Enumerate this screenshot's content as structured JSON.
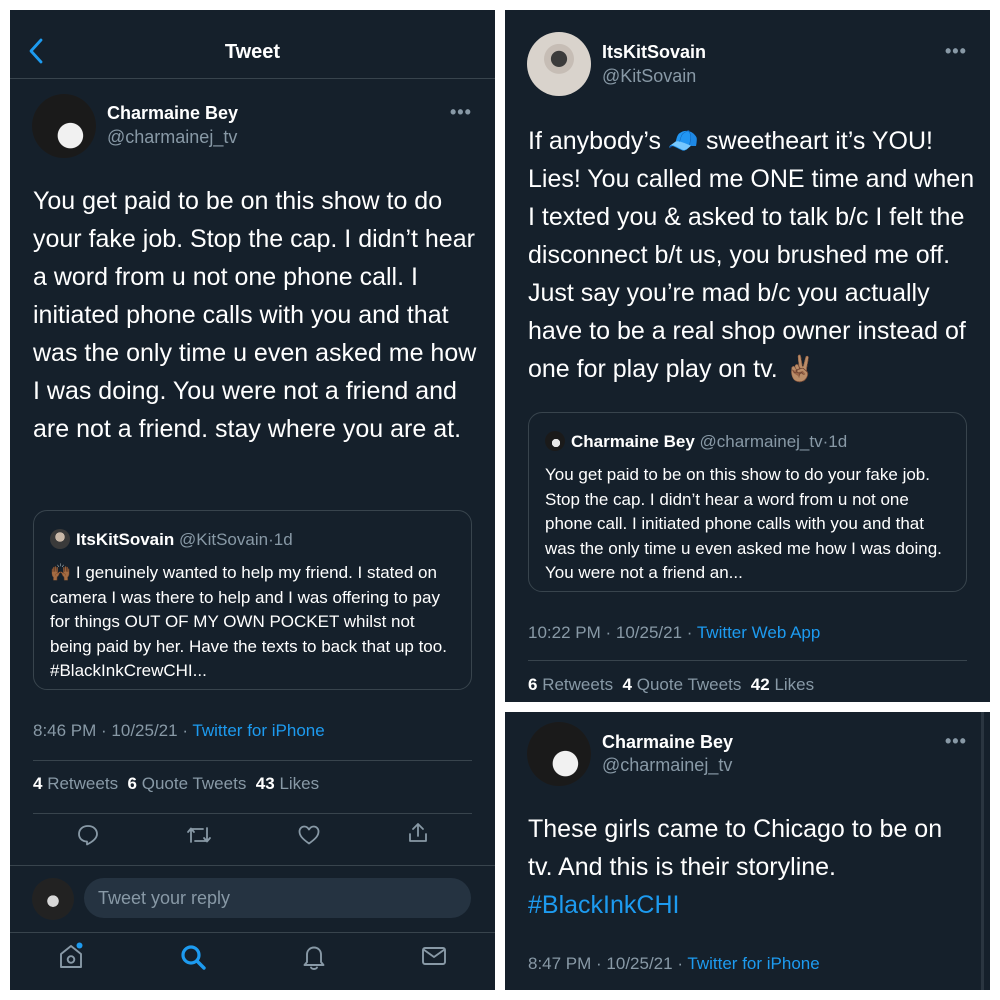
{
  "panel1": {
    "header_title": "Tweet",
    "author": {
      "name": "Charmaine Bey",
      "handle": "@charmainej_tv"
    },
    "body": "You get paid to be on this show to do your fake job. Stop the cap. I didn’t hear a word from u not one phone call. I initiated phone calls with you and that was the only time u even asked me how I was doing. You were not a friend and are not a friend. stay where you are at.",
    "quote": {
      "name": "ItsKitSovain",
      "handle": "@KitSovain",
      "sep": "·",
      "age": "1d",
      "emoji": "🙌🏾",
      "text": "I genuinely wanted to help my friend. I stated on camera I was there to help and I was offering to pay for things OUT OF MY OWN POCKET whilst not being paid by her. Have the texts to back that up too. #BlackInkCrewCHI..."
    },
    "timestamp": "8:46 PM · 10/25/21 · ",
    "source": "Twitter for iPhone",
    "stats": {
      "retweets_count": "4",
      "retweets_label": "Retweets",
      "quotes_count": "6",
      "quotes_label": "Quote Tweets",
      "likes_count": "43",
      "likes_label": "Likes"
    },
    "reply_placeholder": "Tweet your reply",
    "icons": [
      "reply-icon",
      "retweet-icon",
      "like-icon",
      "share-icon",
      "home-icon",
      "search-icon",
      "notifications-icon",
      "messages-icon"
    ]
  },
  "panel2": {
    "author": {
      "name": "ItsKitSovain",
      "handle": "@KitSovain"
    },
    "body_part1": "If anybody’s",
    "body_emoji": "🧢",
    "body_part2": "sweetheart it’s YOU! Lies! You called me ONE time and when I texted you & asked to talk b/c I felt the disconnect b/t us, you brushed me off. Just say you’re mad b/c you actually have to be a real shop owner instead of one for play play on tv. ✌🏽",
    "quote": {
      "name": "Charmaine Bey",
      "handle": "@charmainej_tv",
      "sep": "·",
      "age": "1d",
      "text": "You get paid to be on this show to do your fake job. Stop the cap. I didn’t hear a word from u not one phone call. I initiated phone calls with you and that was the only time u even asked me how I was doing. You were not a friend an..."
    },
    "timestamp": "10:22 PM · 10/25/21 · ",
    "source": "Twitter Web App",
    "stats": {
      "retweets_count": "6",
      "retweets_label": "Retweets",
      "quotes_count": "4",
      "quotes_label": "Quote Tweets",
      "likes_count": "42",
      "likes_label": "Likes"
    }
  },
  "panel3": {
    "author": {
      "name": "Charmaine Bey",
      "handle": "@charmainej_tv"
    },
    "body": "These girls came to Chicago to be on tv. And this is their storyline.",
    "hashtag": "#BlackInkCHI",
    "timestamp": "8:47 PM · 10/25/21 · ",
    "source": "Twitter for iPhone"
  },
  "colors": {
    "background": "#15202b",
    "text": "#ffffff",
    "muted": "#8899a6",
    "accent": "#1d9bf0",
    "border": "#38444d"
  }
}
